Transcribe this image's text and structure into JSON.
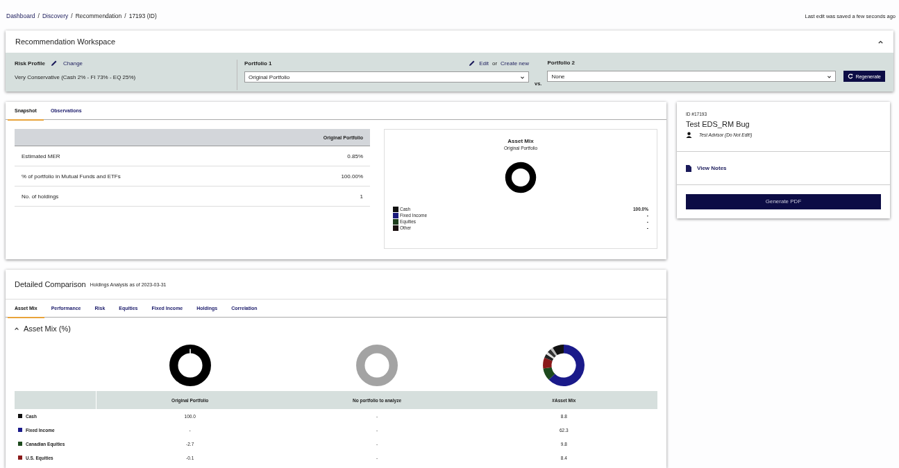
{
  "breadcrumb": [
    {
      "label": "Dashboard",
      "link": true
    },
    {
      "label": "Discovery",
      "link": true
    },
    {
      "label": "Recommendation",
      "link": false
    },
    {
      "label": "17193 (ID)",
      "link": false
    }
  ],
  "breadcrumb_separator": "/",
  "save_status": "Last edit was saved a few seconds ago",
  "workspace": {
    "title": "Recommendation Workspace",
    "expanded": true,
    "risk_label": "Risk Profile",
    "change_link": "Change",
    "risk_value": "Very Conservative (Cash 2% - FI 73% - EQ 25%)",
    "portfolio1_label": "Portfolio 1",
    "edit_link": "Edit",
    "or_text": "or",
    "create_link": "Create new",
    "portfolio1_value": "Original Portfolio",
    "vs_text": "vs.",
    "portfolio2_label": "Portfolio 2",
    "portfolio2_value": "None",
    "regenerate": "Regenerate"
  },
  "snapshot_tabs": [
    {
      "label": "Snapshot",
      "selected": true
    },
    {
      "label": "Observations",
      "selected": false
    }
  ],
  "snapshot_table": {
    "column": "Original Portfolio",
    "rows": [
      {
        "label": "Estimated MER",
        "value": "0.85%"
      },
      {
        "label": "% of portfolio in Mutual Funds and ETFs",
        "value": "100.00%"
      },
      {
        "label": "No. of holdings",
        "value": "1"
      }
    ]
  },
  "asset_mix_card": {
    "title": "Asset Mix",
    "subtitle": "Original Portfolio",
    "legend": [
      {
        "label": "Cash",
        "value": "100.0%",
        "color": "#111111"
      },
      {
        "label": "Fixed Income",
        "value": "-",
        "color": "#1a1a7a"
      },
      {
        "label": "Equities",
        "value": "-",
        "color": "#1d3d1d"
      },
      {
        "label": "Other",
        "value": "-",
        "color": "#1a1010"
      }
    ]
  },
  "record": {
    "id": "ID #17193",
    "title": "Test EDS_RM Bug",
    "advisor": "Test Advisor (Do Not Edit!)",
    "notes_link": "View Notes",
    "pdf_button": "Generate PDF"
  },
  "detailed": {
    "title": "Detailed Comparison",
    "subtitle": "Holdings Analysis as of 2023-03-31",
    "tabs": [
      {
        "label": "Asset Mix",
        "selected": true
      },
      {
        "label": "Performance",
        "selected": false
      },
      {
        "label": "Risk",
        "selected": false
      },
      {
        "label": "Equities",
        "selected": false
      },
      {
        "label": "Fixed Income",
        "selected": false
      },
      {
        "label": "Holdings",
        "selected": false
      },
      {
        "label": "Correlation",
        "selected": false
      }
    ],
    "section": {
      "title": "Asset Mix (%)",
      "expanded": true
    },
    "columns": [
      "Original Portfolio",
      "No portfolio to analyze",
      "#Asset Mix"
    ],
    "rows": [
      {
        "label": "Cash",
        "color": "#111111",
        "values": [
          "100.0",
          "-",
          "8.8"
        ]
      },
      {
        "label": "Fixed Income",
        "color": "#1a1a8a",
        "values": [
          "-",
          "-",
          "62.3"
        ]
      },
      {
        "label": "Canadian Equities",
        "color": "#1d4a1d",
        "values": [
          "-2.7",
          "-",
          "9.8"
        ]
      },
      {
        "label": "U.S. Equities",
        "color": "#8a1a1a",
        "values": [
          "-0.1",
          "-",
          "8.4"
        ]
      }
    ]
  }
}
